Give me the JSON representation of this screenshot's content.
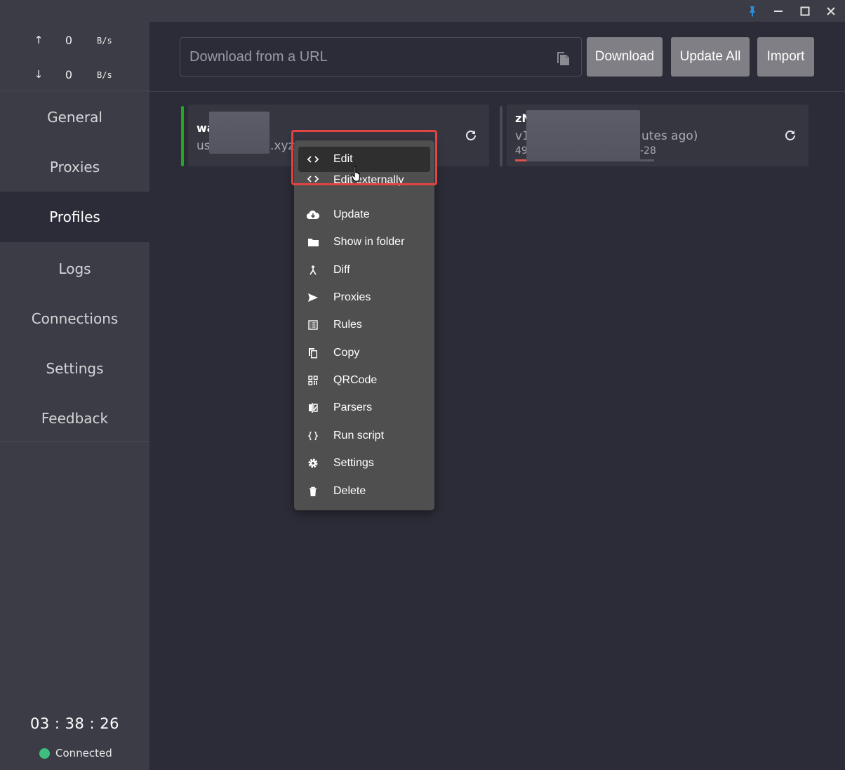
{
  "titlebar": {
    "icons": [
      "pin-icon",
      "minimize-icon",
      "maximize-icon",
      "close-icon"
    ]
  },
  "traffic": {
    "upload": {
      "arrow": "↑",
      "value": "0",
      "unit": "B/s"
    },
    "download": {
      "arrow": "↓",
      "value": "0",
      "unit": "B/s"
    }
  },
  "sidebar": {
    "items": [
      {
        "label": "General"
      },
      {
        "label": "Proxies"
      },
      {
        "label": "Profiles"
      },
      {
        "label": "Logs"
      },
      {
        "label": "Connections"
      },
      {
        "label": "Settings"
      },
      {
        "label": "Feedback"
      }
    ],
    "active": "Profiles",
    "clock": "03 : 38 : 26",
    "status": "Connected"
  },
  "header": {
    "url_placeholder": "Download from a URL",
    "download_label": "Download",
    "update_all_label": "Update All",
    "import_label": "Import"
  },
  "profiles": [
    {
      "name": "wa",
      "url_start": "us",
      "url_end": ".xyz",
      "active": true
    },
    {
      "name": "zN",
      "line2_start": "v1",
      "line2_end": "utes ago)",
      "line3_start": "49",
      "line3_end": "-28",
      "active": false
    }
  ],
  "context_menu": {
    "items": [
      {
        "label": "Edit",
        "icon": "code-icon"
      },
      {
        "label": "Edit externally",
        "icon": "code-icon"
      },
      {
        "label": "Update",
        "icon": "cloud-download-icon"
      },
      {
        "label": "Show in folder",
        "icon": "folder-icon"
      },
      {
        "label": "Diff",
        "icon": "merge-icon"
      },
      {
        "label": "Proxies",
        "icon": "send-icon"
      },
      {
        "label": "Rules",
        "icon": "list-icon"
      },
      {
        "label": "Copy",
        "icon": "copy-icon"
      },
      {
        "label": "QRCode",
        "icon": "qrcode-icon"
      },
      {
        "label": "Parsers",
        "icon": "compare-icon"
      },
      {
        "label": "Run script",
        "icon": "braces-icon"
      },
      {
        "label": "Settings",
        "icon": "gear-icon"
      },
      {
        "label": "Delete",
        "icon": "trash-icon"
      }
    ]
  },
  "colors": {
    "accent_active": "#1faa1f",
    "status_dot": "#3fbf7f",
    "highlight": "#e24343",
    "pin": "#2a8fd6"
  }
}
